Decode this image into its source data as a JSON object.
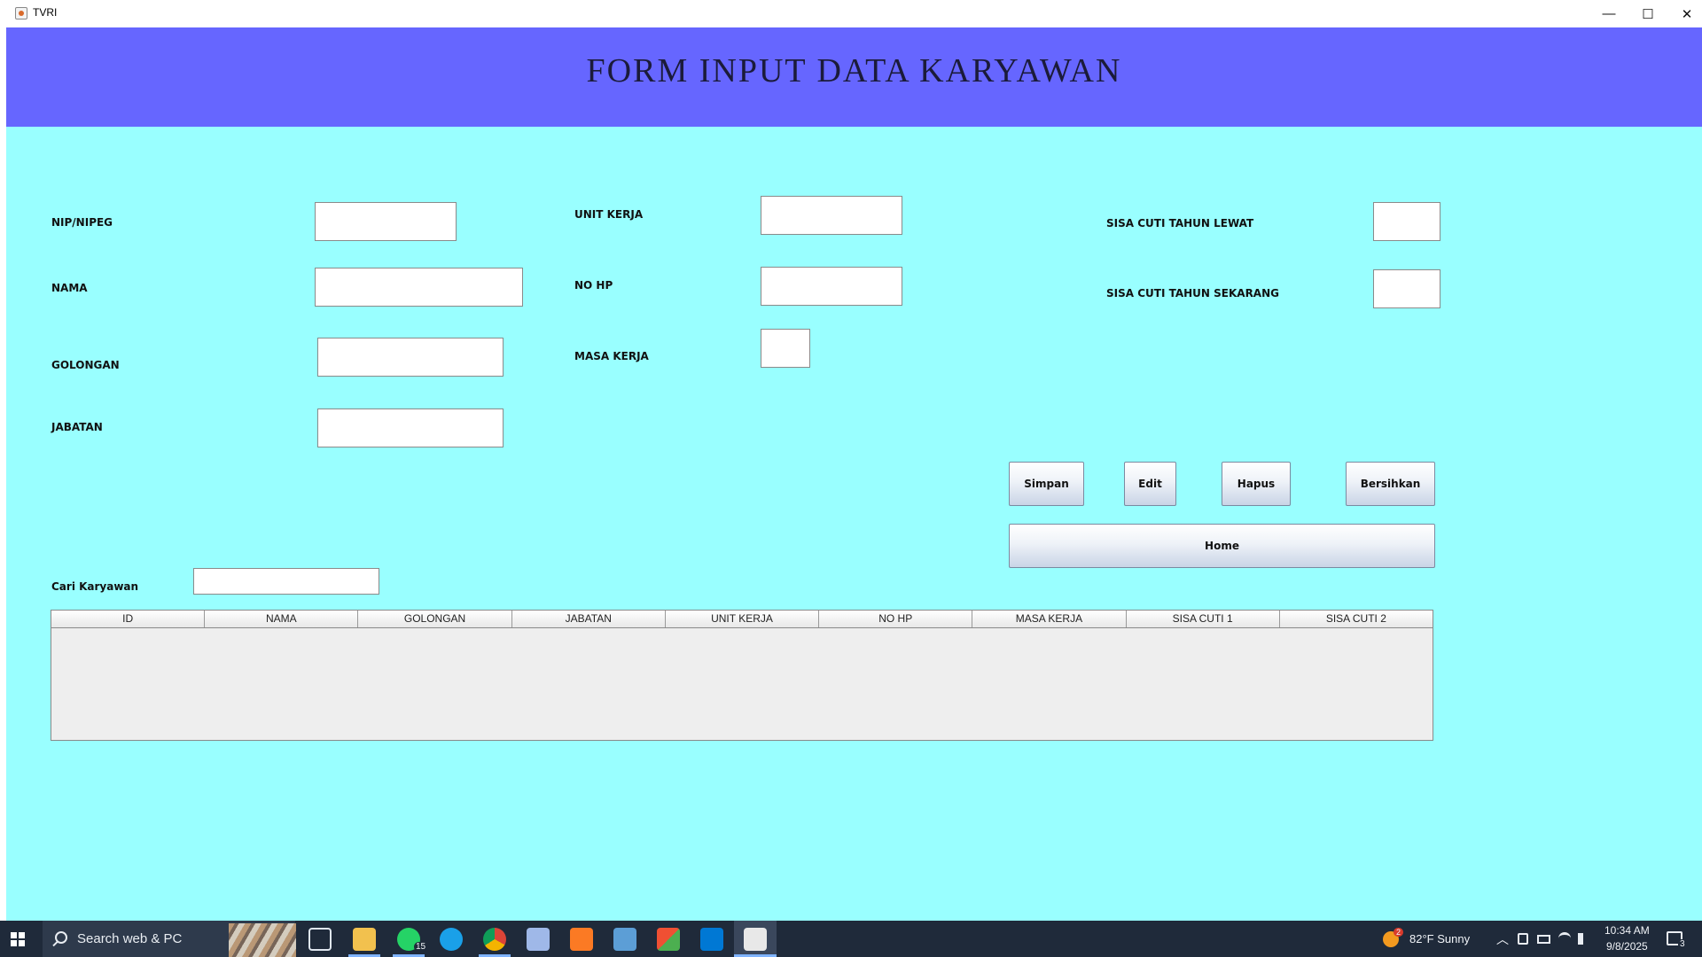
{
  "window": {
    "title": "TVRI",
    "minimize": "—",
    "maximize": "☐",
    "close": "✕"
  },
  "header": {
    "title": "FORM INPUT DATA KARYAWAN"
  },
  "labels": {
    "nip": "NIP/NIPEG",
    "nama": "NAMA",
    "golongan": "GOLONGAN",
    "jabatan": "JABATAN",
    "unit_kerja": "UNIT KERJA",
    "no_hp": "NO HP",
    "masa_kerja": "MASA KERJA",
    "sisa_cuti_lewat": "SISA CUTI TAHUN LEWAT",
    "sisa_cuti_sekarang": "SISA CUTI TAHUN SEKARANG",
    "cari": "Cari Karyawan"
  },
  "buttons": {
    "simpan": "Simpan",
    "edit": "Edit",
    "hapus": "Hapus",
    "bersihkan": "Bersihkan",
    "home": "Home"
  },
  "table": {
    "columns": [
      "ID",
      "NAMA",
      "GOLONGAN",
      "JABATAN",
      "UNIT KERJA",
      "NO HP",
      "MASA KERJA",
      "SISA CUTI 1",
      "SISA CUTI 2"
    ],
    "rows": []
  },
  "taskbar": {
    "search_placeholder": "Search web & PC",
    "whatsapp_badge": "15",
    "weather": "82°F  Sunny",
    "weather_badge": "2",
    "time": "10:34 AM",
    "date": "9/8/2025",
    "notification_count": "3"
  },
  "colors": {
    "header_band": "#6666ff",
    "form_background": "#99ffff",
    "taskbar": "#1f2a3a"
  }
}
